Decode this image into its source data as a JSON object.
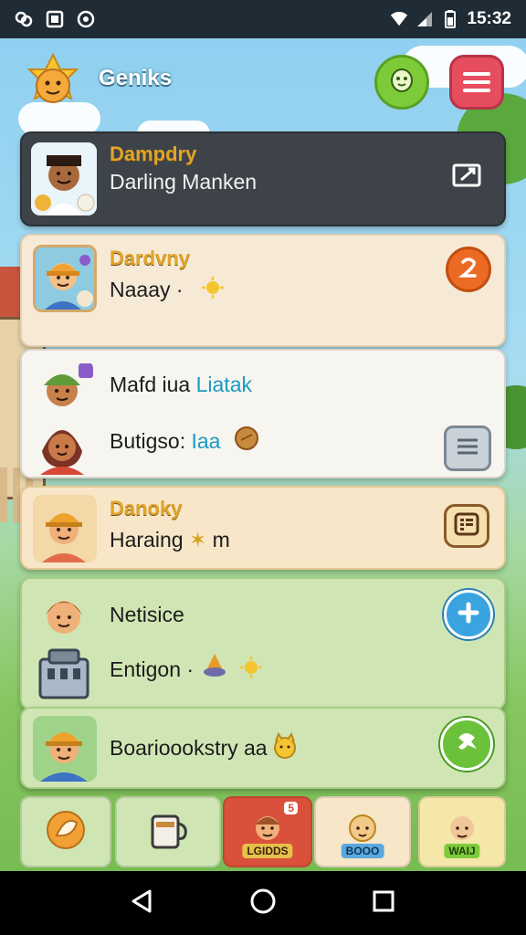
{
  "status_bar": {
    "time": "15:32"
  },
  "header": {
    "app_title": "Geniks"
  },
  "cards": [
    {
      "title": "Dampdry",
      "line1": "Darling Manken"
    },
    {
      "title": "Dardvny",
      "line1": "Naaay ·"
    },
    {
      "line1_a": "Mafd iua ",
      "line1_b": "Liatak",
      "line2_a": "Butigso: ",
      "line2_b": "Iaa"
    },
    {
      "title": "Danoky",
      "line1": "Haraing",
      "line1_suffix": "m"
    },
    {
      "line1": "Netisice",
      "line2": "Entigon ·"
    },
    {
      "line1": "Boarioookstry aa"
    }
  ],
  "bottom_nav": [
    {
      "label": ""
    },
    {
      "label": ""
    },
    {
      "label": "LGIDDS",
      "badge": "5"
    },
    {
      "label": "BOOO"
    },
    {
      "label": "WAIJ"
    }
  ],
  "colors": {
    "status_bar": "#1f2b35",
    "accent_blue": "#1a9bc2",
    "menu_red": "#e64d5f",
    "chat_green": "#7ecb3a"
  },
  "icons": {
    "header": [
      "star-face-logo-icon",
      "chat-bubble-icon",
      "hamburger-menu-icon"
    ],
    "cards": [
      "edit-icon",
      "number-badge-icon",
      "list-icon",
      "document-icon",
      "plus-icon",
      "refresh-icon"
    ],
    "system": [
      "back-icon",
      "home-icon",
      "recents-icon"
    ]
  }
}
